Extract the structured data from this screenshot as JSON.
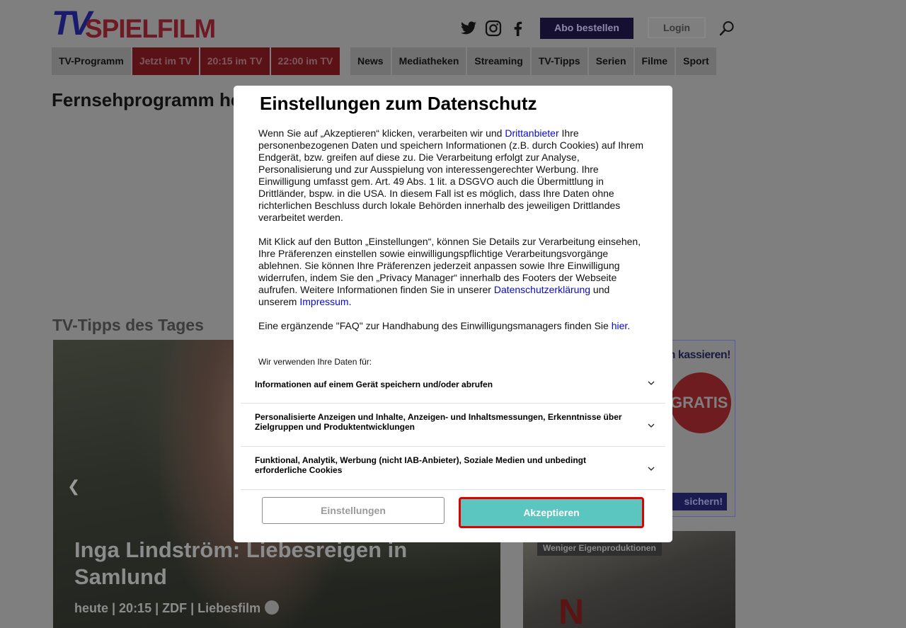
{
  "header": {
    "logo_tv": "TV",
    "logo_spielfilm": "SPIELFILM",
    "abo_label": "Abo bestellen",
    "login_label": "Login"
  },
  "nav": {
    "left": [
      "TV-Programm",
      "Jetzt im TV",
      "20:15 im TV",
      "22:00 im TV"
    ],
    "right": [
      "News",
      "Mediatheken",
      "Streaming",
      "TV-Tipps",
      "Serien",
      "Filme",
      "Sport"
    ]
  },
  "main": {
    "page_title": "Fernsehprogramm heute",
    "tipps_heading": "TV-Tipps des Tages",
    "hero": {
      "title": "Inga Lindström: Liebesreigen in Samlund",
      "meta": "heute | 20:15 | ZDF | Liebesfilm"
    },
    "ad": {
      "headline": "ein kassieren!",
      "badge": "GRATIS",
      "cta": "sichern!"
    },
    "card2": {
      "badge": "Weniger Eigenproduktionen",
      "logo": "N"
    }
  },
  "modal": {
    "title": "Einstellungen zum Datenschutz",
    "p1_a": "Wenn Sie auf „Akzeptieren“ klicken, verarbeiten wir und ",
    "p1_link": "Drittanbieter",
    "p1_b": " Ihre personenbezogenen Daten und speichern Informationen (z.B. durch Cookies) auf Ihrem Endgerät, bzw. greifen auf diese zu. Die Verarbeitung erfolgt zur Analyse, Personalisierung und zur Ausspielung von interessengerechter Werbung. Ihre Einwilligung umfasst gem. Art. 49 Abs. 1 lit. a DSGVO auch die Übermittlung in Drittländer, bspw. in die USA. In diesem Fall ist es möglich, dass Ihre Daten ohne richterlichen Beschluss durch lokale Behörden innerhalb des jeweiligen Drittlandes verarbeitet werden.",
    "p2_a": "Mit Klick auf den Button „Einstellungen“, können Sie Details zur Verarbeitung einsehen, Ihre Präferenzen einstellen sowie einwilligungspflichtige Verarbeitungsvorgänge ablehnen. Sie können Ihre Präferenzen jederzeit anpassen sowie Ihre Einwilligung widerrufen, indem Sie den „Privacy Manager“ innerhalb des Footers der Webseite aufrufen. Weitere Informationen finden Sie in unserer ",
    "p2_link1": "Datenschutzerklärung",
    "p2_b": " und unserem ",
    "p2_link2": "Impressum",
    "p2_c": ".",
    "p3_a": "Eine ergänzende \"FAQ\" zur Handhabung des Einwilligungsmanagers finden Sie ",
    "p3_link": "hier",
    "p3_b": ".",
    "use_title": "Wir verwenden Ihre Daten für:",
    "purposes": [
      "Informationen auf einem Gerät speichern und/oder abrufen",
      "Personalisierte Anzeigen und Inhalte, Anzeigen- und Inhaltsmessungen, Erkenntnisse über Zielgruppen und Produktentwicklungen",
      "Funktional, Analytik, Werbung (nicht IAB-Anbieter), Soziale Medien und unbedingt erforderliche Cookies"
    ],
    "settings_label": "Einstellungen",
    "accept_label": "Akzeptieren"
  },
  "colors": {
    "overlay": "#7f7f7f",
    "accept_bg": "#5bc6c0",
    "accept_border": "#e00000",
    "link": "#0a0ac8"
  }
}
